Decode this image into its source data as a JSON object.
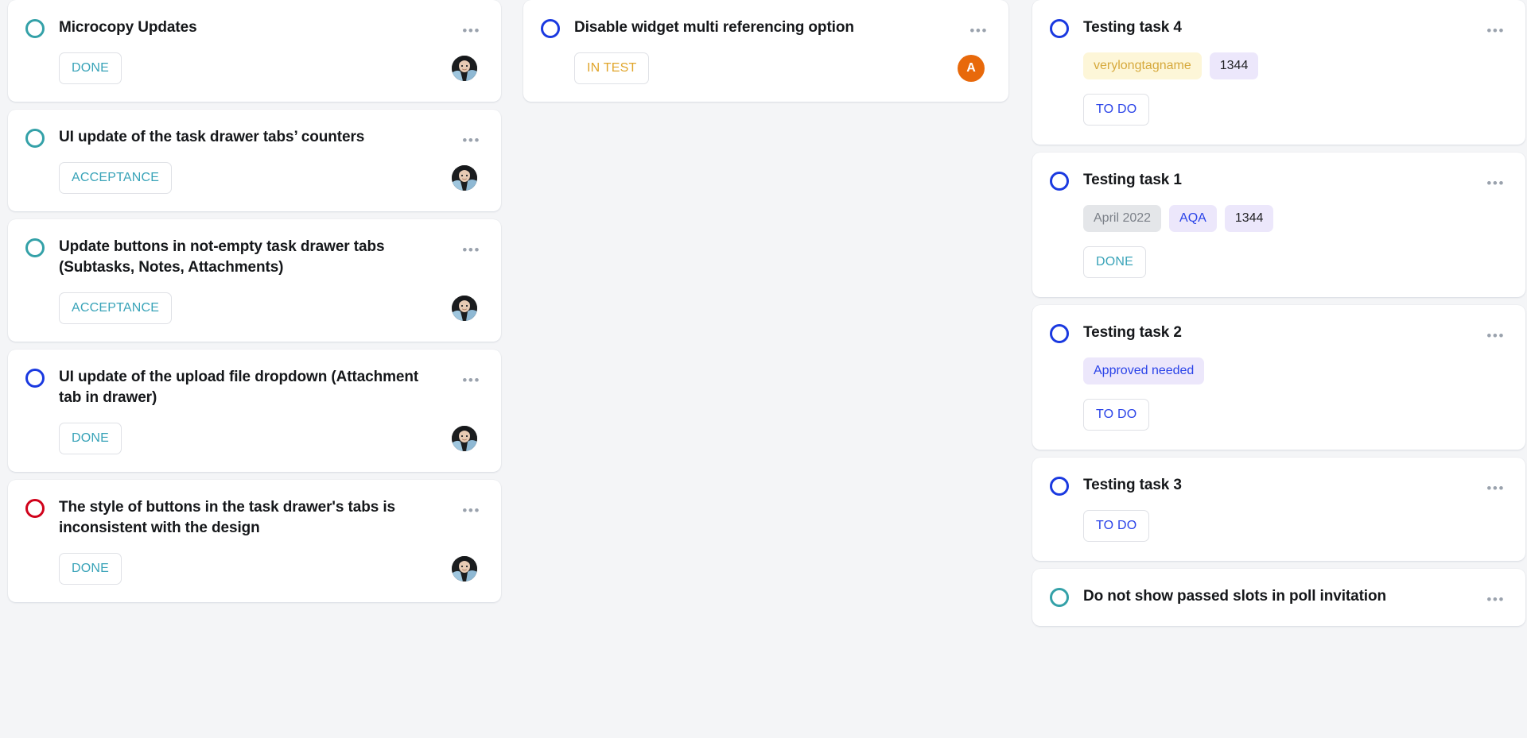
{
  "columns": [
    {
      "name": "column-left",
      "cards": [
        {
          "title": "Microcopy Updates",
          "ring": "teal",
          "status": "DONE",
          "status_kind": "done",
          "menu": "•••",
          "avatar": "photo",
          "tags": []
        },
        {
          "title": "UI update of the task drawer tabs’ counters",
          "ring": "teal",
          "status": "ACCEPTANCE",
          "status_kind": "acceptance",
          "menu": "•••",
          "avatar": "photo",
          "tags": []
        },
        {
          "title": "Update buttons in not-empty task drawer tabs (Subtasks, Notes, Attachments)",
          "ring": "teal",
          "status": "ACCEPTANCE",
          "status_kind": "acceptance",
          "menu": "•••",
          "avatar": "photo",
          "tags": []
        },
        {
          "title": "UI update of the upload file dropdown (Attachment tab in drawer)",
          "ring": "blue",
          "status": "DONE",
          "status_kind": "done",
          "menu": "•••",
          "avatar": "photo",
          "tags": []
        },
        {
          "title": "The style of buttons in the task drawer's tabs is inconsistent with the design",
          "ring": "red",
          "status": "DONE",
          "status_kind": "done",
          "menu": "•••",
          "avatar": "photo",
          "tags": []
        }
      ]
    },
    {
      "name": "column-middle",
      "cards": [
        {
          "title": "Disable widget multi referencing option",
          "ring": "blue",
          "status": "IN TEST",
          "status_kind": "intest",
          "menu": "•••",
          "avatar": "letter",
          "avatar_letter": "A",
          "tags": []
        }
      ]
    },
    {
      "name": "column-right",
      "cards": [
        {
          "title": "Testing task 4",
          "ring": "blue",
          "status": "TO DO",
          "status_kind": "todo",
          "menu": "•••",
          "avatar": "none",
          "tags": [
            {
              "label": "verylongtagname",
              "color": "yellow"
            },
            {
              "label": "1344",
              "color": "purple"
            }
          ]
        },
        {
          "title": "Testing task 1",
          "ring": "blue",
          "status": "DONE",
          "status_kind": "done",
          "menu": "•••",
          "avatar": "none",
          "tags": [
            {
              "label": "April 2022",
              "color": "gray"
            },
            {
              "label": "AQA",
              "color": "blue"
            },
            {
              "label": "1344",
              "color": "purple"
            }
          ]
        },
        {
          "title": "Testing task 2",
          "ring": "blue",
          "status": "TO DO",
          "status_kind": "todo",
          "menu": "•••",
          "avatar": "none",
          "tags": [
            {
              "label": "Approved needed",
              "color": "blue"
            }
          ]
        },
        {
          "title": "Testing task 3",
          "ring": "blue",
          "status": "TO DO",
          "status_kind": "todo",
          "menu": "•••",
          "avatar": "none",
          "tags": []
        },
        {
          "title": "Do not show passed slots in poll invitation",
          "ring": "teal",
          "status": "",
          "status_kind": "",
          "menu": "•••",
          "avatar": "none",
          "tags": []
        }
      ]
    }
  ],
  "colors": {
    "background": "#f4f5f7",
    "card": "#ffffff",
    "ring_teal": "#34a1a8",
    "ring_blue": "#1a39e0",
    "ring_red": "#d0021b",
    "status_done": "#38a3b8",
    "status_intest": "#e0a52b",
    "status_todo": "#2a43e8",
    "avatar_letter_bg": "#e8690b",
    "tag_yellow_bg": "#fdf6d8",
    "tag_purple_bg": "#ece7fb",
    "tag_gray_bg": "#e4e6e9"
  }
}
